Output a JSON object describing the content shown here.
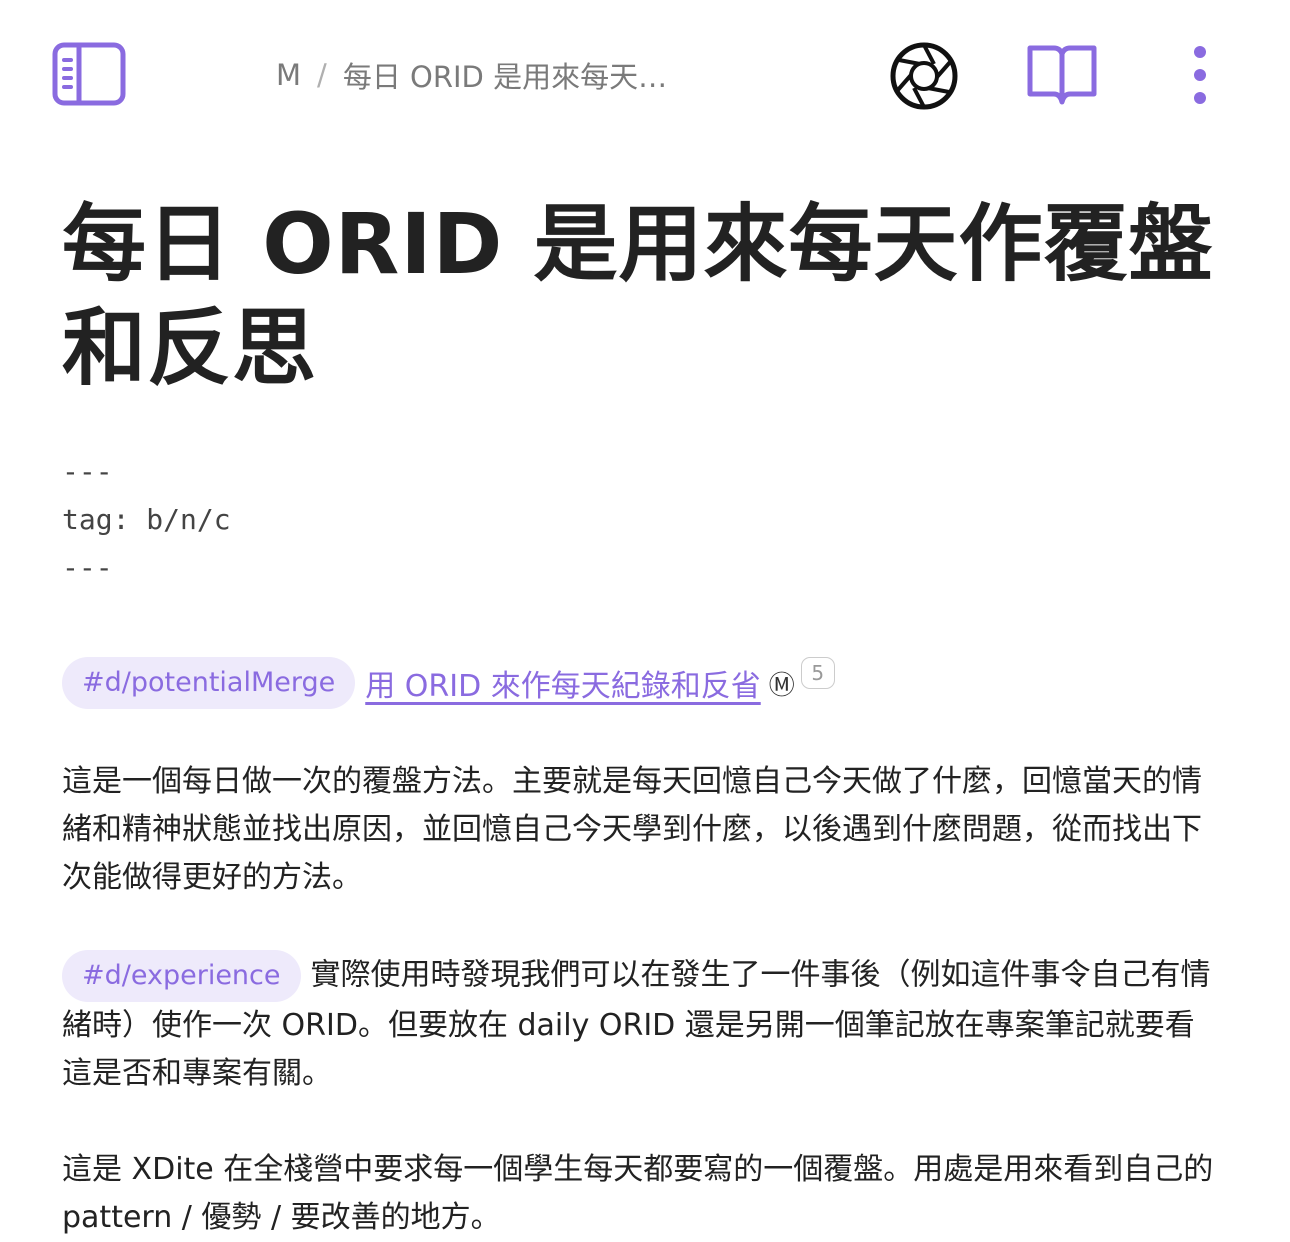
{
  "colors": {
    "accent": "#8a6be0",
    "tag_background": "#eeeafb",
    "text": "#222222",
    "muted": "#7a7a7a"
  },
  "toolbar": {
    "sidebar_icon": "sidebar-toggle-icon",
    "camera_icon": "camera-aperture-icon",
    "reader_icon": "book-open-icon",
    "more_icon": "more-vertical-icon"
  },
  "breadcrumb": {
    "root": "M",
    "separator": "/",
    "current": "每日 ORID 是用來每天…"
  },
  "page": {
    "title": "每日 ORID 是用來每天作覆盤和反思",
    "frontmatter": {
      "open": "---",
      "tag_line": "tag: b/n/c",
      "close": "---"
    },
    "tag_row": {
      "tag": "#d/potentialMerge",
      "link_text": "用 ORID 來作每天紀錄和反省",
      "link_badge": "Ⓜ",
      "count": "5"
    },
    "paragraph1": "這是一個每日做一次的覆盤方法。主要就是每天回憶自己今天做了什麼，回憶當天的情緒和精神狀態並找出原因，並回憶自己今天學到什麼，以後遇到什麼問題，從而找出下次能做得更好的方法。",
    "paragraph2": {
      "tag": "#d/experience",
      "text": "實際使用時發現我們可以在發生了一件事後（例如這件事令自己有情緒時）使作一次 ORID。但要放在 daily ORID 還是另開一個筆記放在專案筆記就要看這是否和專案有關。"
    },
    "paragraph3": "這是 XDite 在全棧營中要求每一個學生每天都要寫的一個覆盤。用處是用來看到自己的 pattern  / 優勢 / 要改善的地方。"
  }
}
